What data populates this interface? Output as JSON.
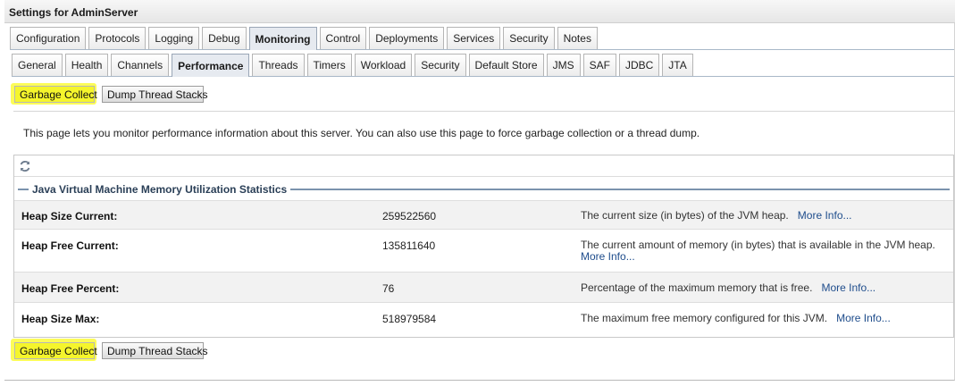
{
  "title": "Settings for AdminServer",
  "main_tabs": [
    {
      "label": "Configuration",
      "active": false
    },
    {
      "label": "Protocols",
      "active": false
    },
    {
      "label": "Logging",
      "active": false
    },
    {
      "label": "Debug",
      "active": false
    },
    {
      "label": "Monitoring",
      "active": true
    },
    {
      "label": "Control",
      "active": false
    },
    {
      "label": "Deployments",
      "active": false
    },
    {
      "label": "Services",
      "active": false
    },
    {
      "label": "Security",
      "active": false
    },
    {
      "label": "Notes",
      "active": false
    }
  ],
  "sub_tabs": [
    {
      "label": "General",
      "active": false
    },
    {
      "label": "Health",
      "active": false
    },
    {
      "label": "Channels",
      "active": false
    },
    {
      "label": "Performance",
      "active": true
    },
    {
      "label": "Threads",
      "active": false
    },
    {
      "label": "Timers",
      "active": false
    },
    {
      "label": "Workload",
      "active": false
    },
    {
      "label": "Security",
      "active": false
    },
    {
      "label": "Default Store",
      "active": false
    },
    {
      "label": "JMS",
      "active": false
    },
    {
      "label": "SAF",
      "active": false
    },
    {
      "label": "JDBC",
      "active": false
    },
    {
      "label": "JTA",
      "active": false
    }
  ],
  "buttons": {
    "garbage_collect": "Garbage Collect",
    "dump_thread_stacks": "Dump Thread Stacks"
  },
  "description": "This page lets you monitor performance information about this server. You can also use this page to force garbage collection or a thread dump.",
  "section_title": "Java Virtual Machine Memory Utilization Statistics",
  "more_info": "More Info...",
  "rows": [
    {
      "label": "Heap Size Current:",
      "value": "259522560",
      "info": "The current size (in bytes) of the JVM heap."
    },
    {
      "label": "Heap Free Current:",
      "value": "135811640",
      "info": "The current amount of memory (in bytes) that is available in the JVM heap."
    },
    {
      "label": "Heap Free Percent:",
      "value": "76",
      "info": "Percentage of the maximum memory that is free."
    },
    {
      "label": "Heap Size Max:",
      "value": "518979584",
      "info": "The maximum free memory configured for this JVM."
    }
  ],
  "colors": {
    "highlight": "#f5f52c",
    "link": "#1f4d8c",
    "legend": "#2a3f57"
  },
  "icons": {
    "refresh": "refresh-icon"
  }
}
